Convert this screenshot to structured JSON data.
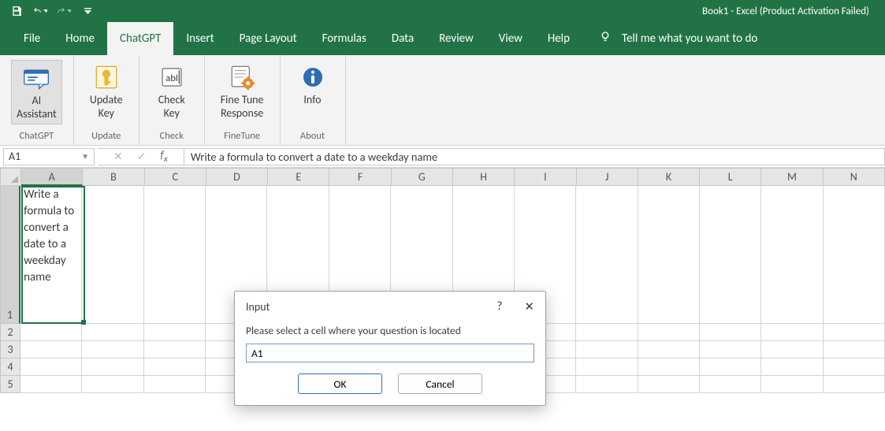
{
  "title_bar": {
    "app_title": "Book1  -  Excel (Product Activation Failed)"
  },
  "ribbon": {
    "tabs": [
      "File",
      "Home",
      "ChatGPT",
      "Insert",
      "Page Layout",
      "Formulas",
      "Data",
      "Review",
      "View",
      "Help"
    ],
    "active_tab": "ChatGPT",
    "tell_me": "Tell me what you want to do",
    "groups": {
      "g1": {
        "button": "AI\nAssistant",
        "label": "ChatGPT"
      },
      "g2": {
        "button": "Update\nKey",
        "label": "Update"
      },
      "g3": {
        "button": "Check\nKey",
        "label": "Check"
      },
      "g4": {
        "button": "Fine Tune\nResponse",
        "label": "FineTune"
      },
      "g5": {
        "button": "Info",
        "label": "About"
      }
    }
  },
  "formula_bar": {
    "namebox": "A1",
    "formula": "Write a formula to convert a date to a weekday name"
  },
  "grid": {
    "columns": [
      "A",
      "B",
      "C",
      "D",
      "E",
      "F",
      "G",
      "H",
      "I",
      "J",
      "K",
      "L",
      "M",
      "N"
    ],
    "selected_col": "A",
    "rows": [
      "1",
      "2",
      "3",
      "4",
      "5"
    ],
    "selected_row": "1",
    "a1_content": "Write a formula to convert a date to a weekday name"
  },
  "dialog": {
    "title": "Input",
    "message": "Please select a cell where your question is located",
    "input_value": "A1",
    "ok": "OK",
    "cancel": "Cancel"
  }
}
